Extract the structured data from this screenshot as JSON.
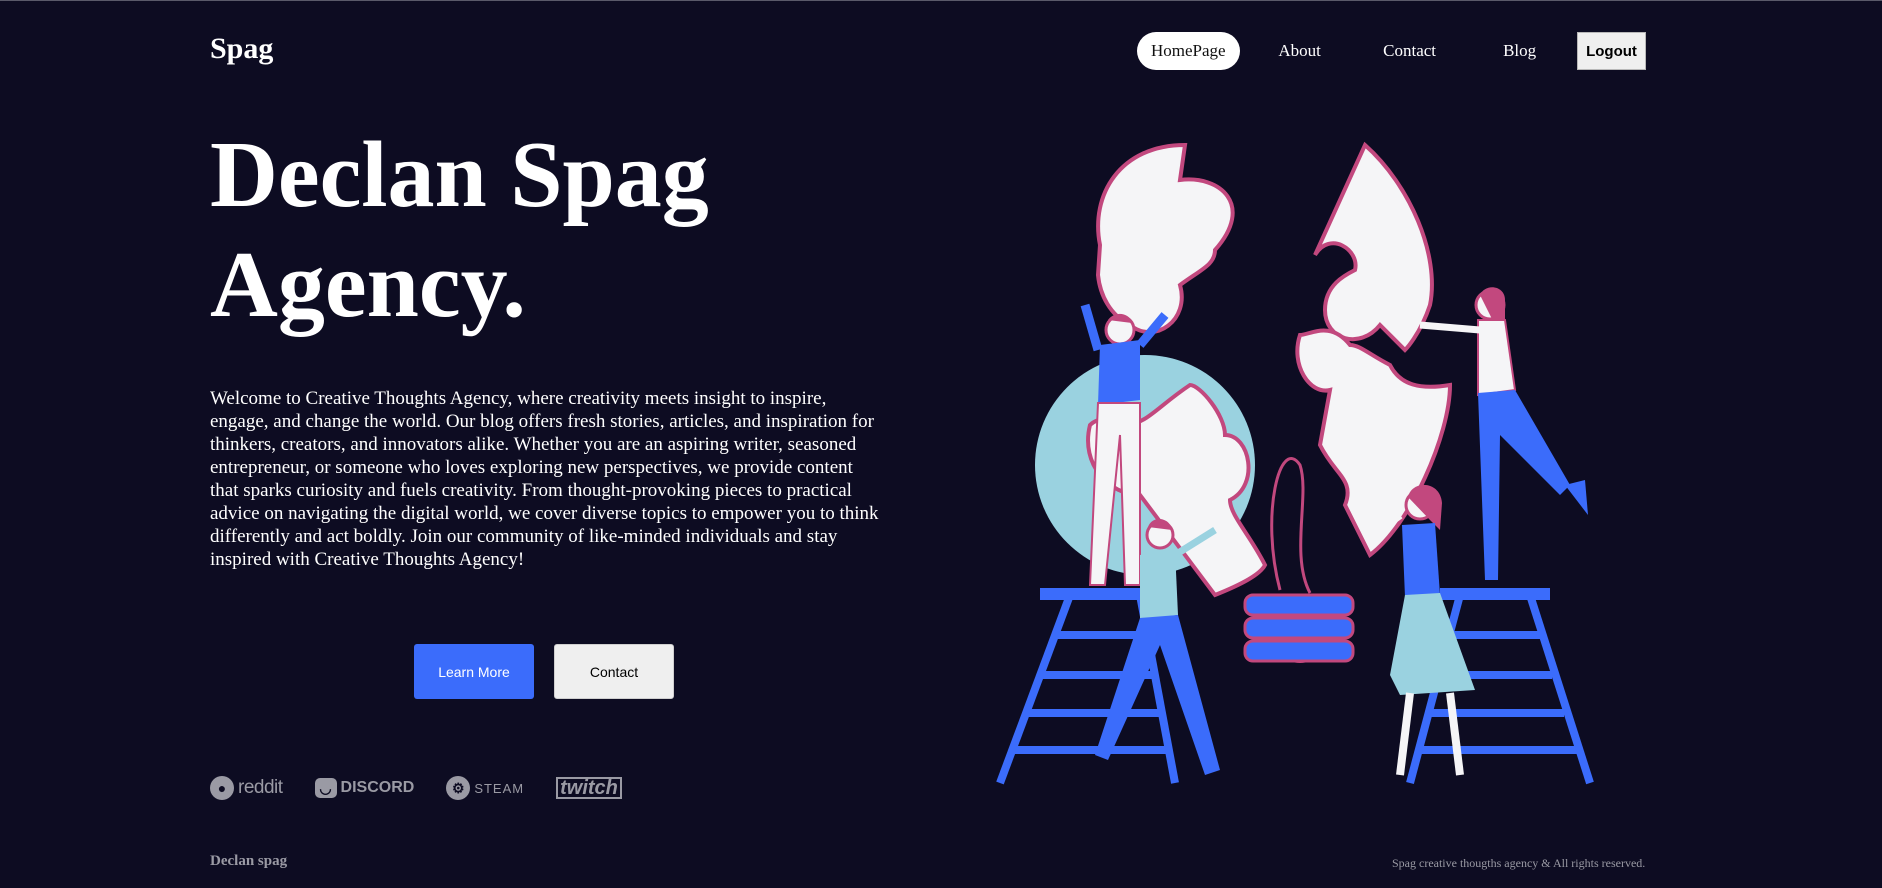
{
  "nav": {
    "logo": "Spag",
    "items": [
      {
        "label": "HomePage"
      },
      {
        "label": "About"
      },
      {
        "label": "Contact"
      },
      {
        "label": "Blog"
      }
    ],
    "logout": "Logout"
  },
  "hero": {
    "title_line1": "Declan Spag",
    "title_line2": "Agency.",
    "description": "Welcome to Creative Thoughts Agency, where creativity meets insight to inspire, engage, and change the world. Our blog offers fresh stories, articles, and inspiration for thinkers, creators, and innovators alike. Whether you are an aspiring writer, seasoned entrepreneur, or someone who loves exploring new perspectives, we provide content that sparks curiosity and fuels creativity. From thought-provoking pieces to practical advice on navigating the digital world, we cover diverse topics to empower you to think differently and act boldly. Join our community of like-minded individuals and stay inspired with Creative Thoughts Agency!",
    "learn_more": "Learn More",
    "contact": "Contact"
  },
  "brands": [
    {
      "name": "reddit",
      "icon": "reddit-icon"
    },
    {
      "name": "DISCORD",
      "icon": "discord-icon"
    },
    {
      "name": "STEAM",
      "icon": "steam-icon"
    },
    {
      "name": "twitch",
      "icon": "twitch-icon"
    }
  ],
  "footer": {
    "left": "Declan spag",
    "right": "Spag creative thougths agency & All rights reserved."
  },
  "colors": {
    "background": "#0d0c22",
    "accent_blue": "#3b6cfb",
    "accent_pink": "#c2487e",
    "light_blue": "#9ad2e0"
  }
}
